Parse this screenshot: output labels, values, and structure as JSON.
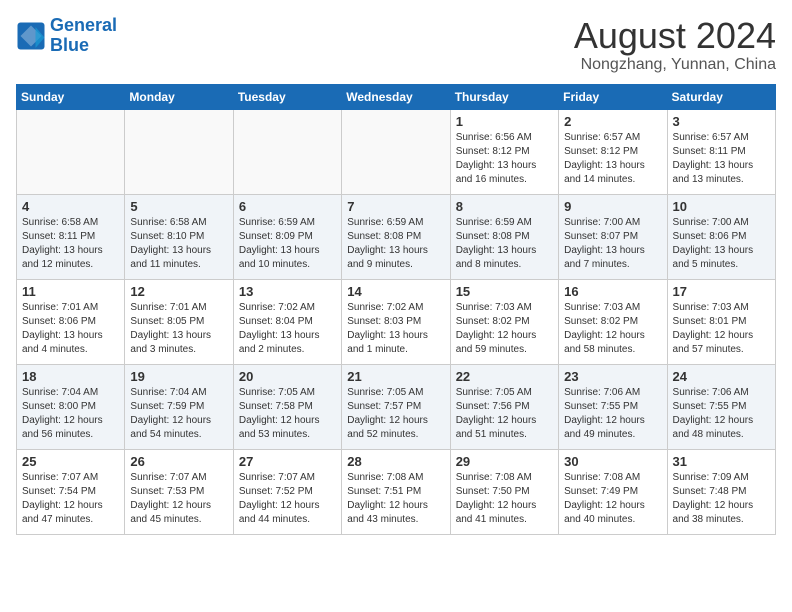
{
  "header": {
    "logo_line1": "General",
    "logo_line2": "Blue",
    "month_year": "August 2024",
    "location": "Nongzhang, Yunnan, China"
  },
  "weekdays": [
    "Sunday",
    "Monday",
    "Tuesday",
    "Wednesday",
    "Thursday",
    "Friday",
    "Saturday"
  ],
  "weeks": [
    [
      {
        "day": "",
        "info": ""
      },
      {
        "day": "",
        "info": ""
      },
      {
        "day": "",
        "info": ""
      },
      {
        "day": "",
        "info": ""
      },
      {
        "day": "1",
        "info": "Sunrise: 6:56 AM\nSunset: 8:12 PM\nDaylight: 13 hours\nand 16 minutes."
      },
      {
        "day": "2",
        "info": "Sunrise: 6:57 AM\nSunset: 8:12 PM\nDaylight: 13 hours\nand 14 minutes."
      },
      {
        "day": "3",
        "info": "Sunrise: 6:57 AM\nSunset: 8:11 PM\nDaylight: 13 hours\nand 13 minutes."
      }
    ],
    [
      {
        "day": "4",
        "info": "Sunrise: 6:58 AM\nSunset: 8:11 PM\nDaylight: 13 hours\nand 12 minutes."
      },
      {
        "day": "5",
        "info": "Sunrise: 6:58 AM\nSunset: 8:10 PM\nDaylight: 13 hours\nand 11 minutes."
      },
      {
        "day": "6",
        "info": "Sunrise: 6:59 AM\nSunset: 8:09 PM\nDaylight: 13 hours\nand 10 minutes."
      },
      {
        "day": "7",
        "info": "Sunrise: 6:59 AM\nSunset: 8:08 PM\nDaylight: 13 hours\nand 9 minutes."
      },
      {
        "day": "8",
        "info": "Sunrise: 6:59 AM\nSunset: 8:08 PM\nDaylight: 13 hours\nand 8 minutes."
      },
      {
        "day": "9",
        "info": "Sunrise: 7:00 AM\nSunset: 8:07 PM\nDaylight: 13 hours\nand 7 minutes."
      },
      {
        "day": "10",
        "info": "Sunrise: 7:00 AM\nSunset: 8:06 PM\nDaylight: 13 hours\nand 5 minutes."
      }
    ],
    [
      {
        "day": "11",
        "info": "Sunrise: 7:01 AM\nSunset: 8:06 PM\nDaylight: 13 hours\nand 4 minutes."
      },
      {
        "day": "12",
        "info": "Sunrise: 7:01 AM\nSunset: 8:05 PM\nDaylight: 13 hours\nand 3 minutes."
      },
      {
        "day": "13",
        "info": "Sunrise: 7:02 AM\nSunset: 8:04 PM\nDaylight: 13 hours\nand 2 minutes."
      },
      {
        "day": "14",
        "info": "Sunrise: 7:02 AM\nSunset: 8:03 PM\nDaylight: 13 hours\nand 1 minute."
      },
      {
        "day": "15",
        "info": "Sunrise: 7:03 AM\nSunset: 8:02 PM\nDaylight: 12 hours\nand 59 minutes."
      },
      {
        "day": "16",
        "info": "Sunrise: 7:03 AM\nSunset: 8:02 PM\nDaylight: 12 hours\nand 58 minutes."
      },
      {
        "day": "17",
        "info": "Sunrise: 7:03 AM\nSunset: 8:01 PM\nDaylight: 12 hours\nand 57 minutes."
      }
    ],
    [
      {
        "day": "18",
        "info": "Sunrise: 7:04 AM\nSunset: 8:00 PM\nDaylight: 12 hours\nand 56 minutes."
      },
      {
        "day": "19",
        "info": "Sunrise: 7:04 AM\nSunset: 7:59 PM\nDaylight: 12 hours\nand 54 minutes."
      },
      {
        "day": "20",
        "info": "Sunrise: 7:05 AM\nSunset: 7:58 PM\nDaylight: 12 hours\nand 53 minutes."
      },
      {
        "day": "21",
        "info": "Sunrise: 7:05 AM\nSunset: 7:57 PM\nDaylight: 12 hours\nand 52 minutes."
      },
      {
        "day": "22",
        "info": "Sunrise: 7:05 AM\nSunset: 7:56 PM\nDaylight: 12 hours\nand 51 minutes."
      },
      {
        "day": "23",
        "info": "Sunrise: 7:06 AM\nSunset: 7:55 PM\nDaylight: 12 hours\nand 49 minutes."
      },
      {
        "day": "24",
        "info": "Sunrise: 7:06 AM\nSunset: 7:55 PM\nDaylight: 12 hours\nand 48 minutes."
      }
    ],
    [
      {
        "day": "25",
        "info": "Sunrise: 7:07 AM\nSunset: 7:54 PM\nDaylight: 12 hours\nand 47 minutes."
      },
      {
        "day": "26",
        "info": "Sunrise: 7:07 AM\nSunset: 7:53 PM\nDaylight: 12 hours\nand 45 minutes."
      },
      {
        "day": "27",
        "info": "Sunrise: 7:07 AM\nSunset: 7:52 PM\nDaylight: 12 hours\nand 44 minutes."
      },
      {
        "day": "28",
        "info": "Sunrise: 7:08 AM\nSunset: 7:51 PM\nDaylight: 12 hours\nand 43 minutes."
      },
      {
        "day": "29",
        "info": "Sunrise: 7:08 AM\nSunset: 7:50 PM\nDaylight: 12 hours\nand 41 minutes."
      },
      {
        "day": "30",
        "info": "Sunrise: 7:08 AM\nSunset: 7:49 PM\nDaylight: 12 hours\nand 40 minutes."
      },
      {
        "day": "31",
        "info": "Sunrise: 7:09 AM\nSunset: 7:48 PM\nDaylight: 12 hours\nand 38 minutes."
      }
    ]
  ]
}
